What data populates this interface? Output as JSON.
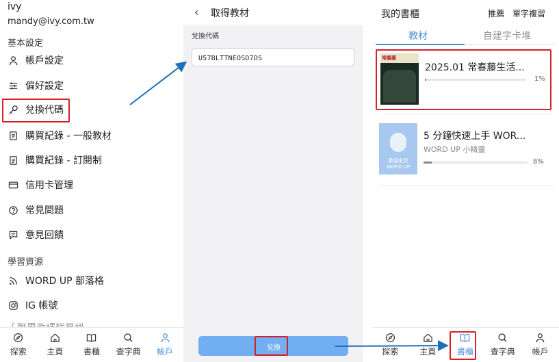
{
  "account_panel": {
    "user_name": "ivy",
    "user_email": "mandy@ivy.com.tw",
    "section_basic": "基本設定",
    "basic_items": [
      {
        "label": "帳戶設定",
        "icon": "person-icon"
      },
      {
        "label": "偏好設定",
        "icon": "sliders-icon"
      },
      {
        "label": "兌換代碼",
        "icon": "key-icon"
      },
      {
        "label": "購買紀錄 - 一般教材",
        "icon": "document-icon"
      },
      {
        "label": "購買紀錄 - 訂閱制",
        "icon": "document-icon"
      },
      {
        "label": "信用卡管理",
        "icon": "credit-card-icon"
      },
      {
        "label": "常見問題",
        "icon": "question-circle-icon"
      },
      {
        "label": "意見回饋",
        "icon": "message-icon"
      }
    ],
    "section_learning": "學習資源",
    "learning_items": [
      {
        "label": "WORD UP 部落格",
        "icon": "rss-icon"
      },
      {
        "label": "IG 帳號",
        "icon": "instagram-icon"
      }
    ],
    "cut_off_text": "了解更多課程資訊",
    "tabbar": {
      "items": [
        {
          "label": "探索",
          "icon": "compass-icon"
        },
        {
          "label": "主頁",
          "icon": "home-icon"
        },
        {
          "label": "書櫃",
          "icon": "book-icon"
        },
        {
          "label": "查字典",
          "icon": "search-icon"
        },
        {
          "label": "帳戶",
          "icon": "person-icon"
        }
      ],
      "active_index": 4
    }
  },
  "redeem_panel": {
    "back_glyph": "‹",
    "title": "取得教材",
    "field_label": "兌換代碼",
    "code_value": "U57BLTTNEOSD7DS",
    "submit_label": "兌換"
  },
  "bookshelf_panel": {
    "title": "我的書櫃",
    "links": [
      "推薦",
      "單字複習"
    ],
    "tabs": [
      "教材",
      "自建字卡堆"
    ],
    "active_tab": 0,
    "books": [
      {
        "title": "2025.01 常春藤生活...",
        "subtitle": "",
        "progress": 0.01,
        "progress_label": "1%",
        "cover_text": "常春藤"
      },
      {
        "title": "5 分鐘快速上手 WOR...",
        "subtitle": "WORD UP 小精靈",
        "progress": 0.08,
        "progress_label": "8%",
        "cover_text_1": "歡迎來到",
        "cover_text_2": "WORD UP"
      }
    ],
    "tabbar": {
      "items": [
        {
          "label": "探索",
          "icon": "compass-icon"
        },
        {
          "label": "主頁",
          "icon": "home-icon"
        },
        {
          "label": "書櫃",
          "icon": "book-icon"
        },
        {
          "label": "查字典",
          "icon": "search-icon"
        },
        {
          "label": "帳戶",
          "icon": "person-icon"
        }
      ],
      "active_index": 2
    }
  },
  "colors": {
    "highlight": "#d61f26",
    "accent": "#4a90d9",
    "button": "#72aef2",
    "arrow": "#1c6fb8"
  }
}
